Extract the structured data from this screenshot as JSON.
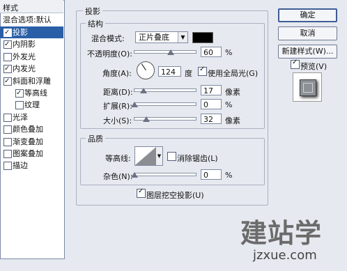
{
  "styles_panel": {
    "header": "样式",
    "blend_item": "混合选项:默认",
    "items": [
      {
        "label": "投影",
        "checked": true,
        "selected": true,
        "sub": false
      },
      {
        "label": "内阴影",
        "checked": true,
        "selected": false,
        "sub": false
      },
      {
        "label": "外发光",
        "checked": false,
        "selected": false,
        "sub": false
      },
      {
        "label": "内发光",
        "checked": true,
        "selected": false,
        "sub": false
      },
      {
        "label": "斜面和浮雕",
        "checked": true,
        "selected": false,
        "sub": false
      },
      {
        "label": "等高线",
        "checked": true,
        "selected": false,
        "sub": true
      },
      {
        "label": "纹理",
        "checked": false,
        "selected": false,
        "sub": true
      },
      {
        "label": "光泽",
        "checked": false,
        "selected": false,
        "sub": false
      },
      {
        "label": "颜色叠加",
        "checked": false,
        "selected": false,
        "sub": false
      },
      {
        "label": "渐变叠加",
        "checked": false,
        "selected": false,
        "sub": false
      },
      {
        "label": "图案叠加",
        "checked": false,
        "selected": false,
        "sub": false
      },
      {
        "label": "描边",
        "checked": false,
        "selected": false,
        "sub": false
      }
    ]
  },
  "drop_shadow": {
    "title": "投影",
    "structure": {
      "title": "结构",
      "blend_mode_label": "混合模式:",
      "blend_mode_value": "正片叠底",
      "shadow_color": "#000000",
      "opacity_label": "不透明度(O):",
      "opacity_value": "60",
      "opacity_unit": "%",
      "opacity_fraction": 0.6,
      "angle_label": "角度(A):",
      "angle_value": "124",
      "angle_unit": "度",
      "global_light_label": "使用全局光(G)",
      "global_light_checked": true,
      "distance_label": "距离(D):",
      "distance_value": "17",
      "distance_unit": "像素",
      "spread_label": "扩展(R):",
      "spread_value": "0",
      "spread_unit": "%",
      "size_label": "大小(S):",
      "size_value": "32",
      "size_unit": "像素"
    },
    "quality": {
      "title": "品质",
      "contour_label": "等高线:",
      "anti_alias_label": "消除锯齿(L)",
      "anti_alias_checked": false,
      "noise_label": "杂色(N):",
      "noise_value": "0",
      "noise_unit": "%"
    },
    "knockout_label": "图层挖空投影(U)",
    "knockout_checked": true
  },
  "buttons": {
    "ok": "确定",
    "cancel": "取消",
    "new_style": "新建样式(W)...",
    "preview_label": "预览(V)",
    "preview_checked": true
  },
  "watermark": {
    "cn": "建站学",
    "en": "jzxue.com"
  }
}
